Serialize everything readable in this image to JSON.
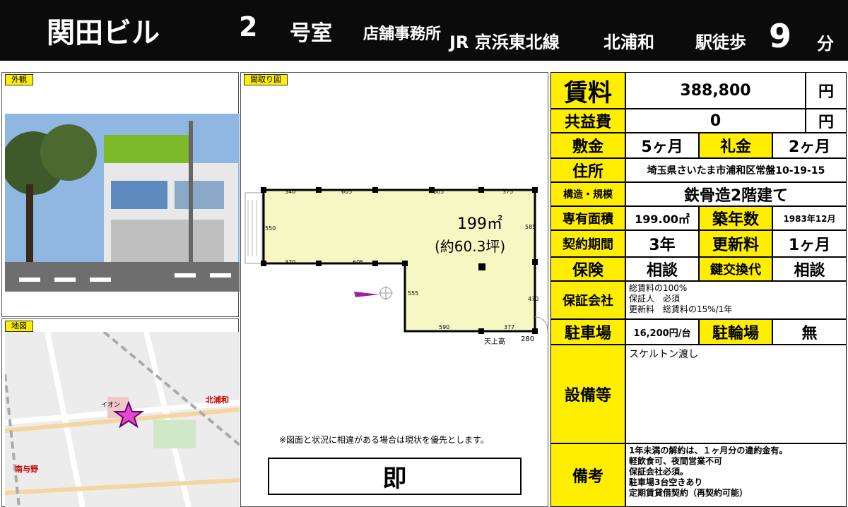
{
  "header": {
    "building_name": "関田ビル",
    "room_number": "2",
    "room_suffix": "号室",
    "usage": "店舗事務所",
    "line": "JR 京浜東北線",
    "station": "北浦和",
    "walk_label": "駅徒歩",
    "walk_minutes": "9",
    "minutes_suffix": "分"
  },
  "panels": {
    "exterior_label": "外観",
    "floorplan_label": "間取り図",
    "map_label": "地図"
  },
  "floorplan": {
    "area_text": "199㎡",
    "tsubo_text": "(約60.3坪)",
    "dims_top": [
      "340",
      "605",
      "605",
      "375"
    ],
    "dims_mid": [
      "370",
      "605"
    ],
    "dim_left": "550",
    "dim_right_top": "585",
    "dim_inner": "555",
    "dim_right_bottom": "470",
    "dims_bottom": [
      "590",
      "377"
    ],
    "ceiling_label": "天上高",
    "ceiling_value": "280"
  },
  "map_labels": {
    "kitaurawa": "北浦和",
    "minamiyono": "南与野",
    "aeon": "イオン"
  },
  "note": "※図面と状況に相違がある場合は現状を優先とします。",
  "availability": "即",
  "table": {
    "rent_label": "賃料",
    "rent_value": "388,800",
    "rent_unit": "円",
    "common_label": "共益費",
    "common_value": "0",
    "common_unit": "円",
    "deposit_label": "敷金",
    "deposit_value": "5ヶ月",
    "key_money_label": "礼金",
    "key_money_value": "2ヶ月",
    "address_label": "住所",
    "address_value": "埼玉県さいたま市浦和区常盤10-19-15",
    "structure_label": "構造・規模",
    "structure_value": "鉄骨造2階建て",
    "area_label": "専有面積",
    "area_value": "199.00㎡",
    "built_label": "築年数",
    "built_value": "1983年12月",
    "contract_label": "契約期間",
    "contract_value": "3年",
    "renewal_label": "更新料",
    "renewal_value": "1ヶ月",
    "insurance_label": "保険",
    "insurance_value": "相談",
    "key_exchange_label": "鍵交換代",
    "key_exchange_value": "相談",
    "guarantee_label": "保証会社",
    "guarantee_lines": [
      "総賃料の100%",
      "保証人　必須",
      "更新料　総賃料の15%/1年"
    ],
    "parking_label": "駐車場",
    "parking_value": "16,200円/台",
    "bicycle_label": "駐輪場",
    "bicycle_value": "無",
    "equipment_label": "設備等",
    "equipment_value": "スケルトン渡し",
    "remarks_label": "備考",
    "remarks_lines": [
      "1年未満の解約は、１ヶ月分の違約金有。",
      "軽飲食可、夜間営業不可",
      "保証会社必須。",
      "駐車場3台空きあり",
      "定期賃貸借契約（再契約可能）"
    ]
  },
  "colors": {
    "header_bg": "#0b0b0b",
    "label_yellow": "#ffee00",
    "floor_fill": "#f7f7c4",
    "map_star": "#a0208c"
  }
}
